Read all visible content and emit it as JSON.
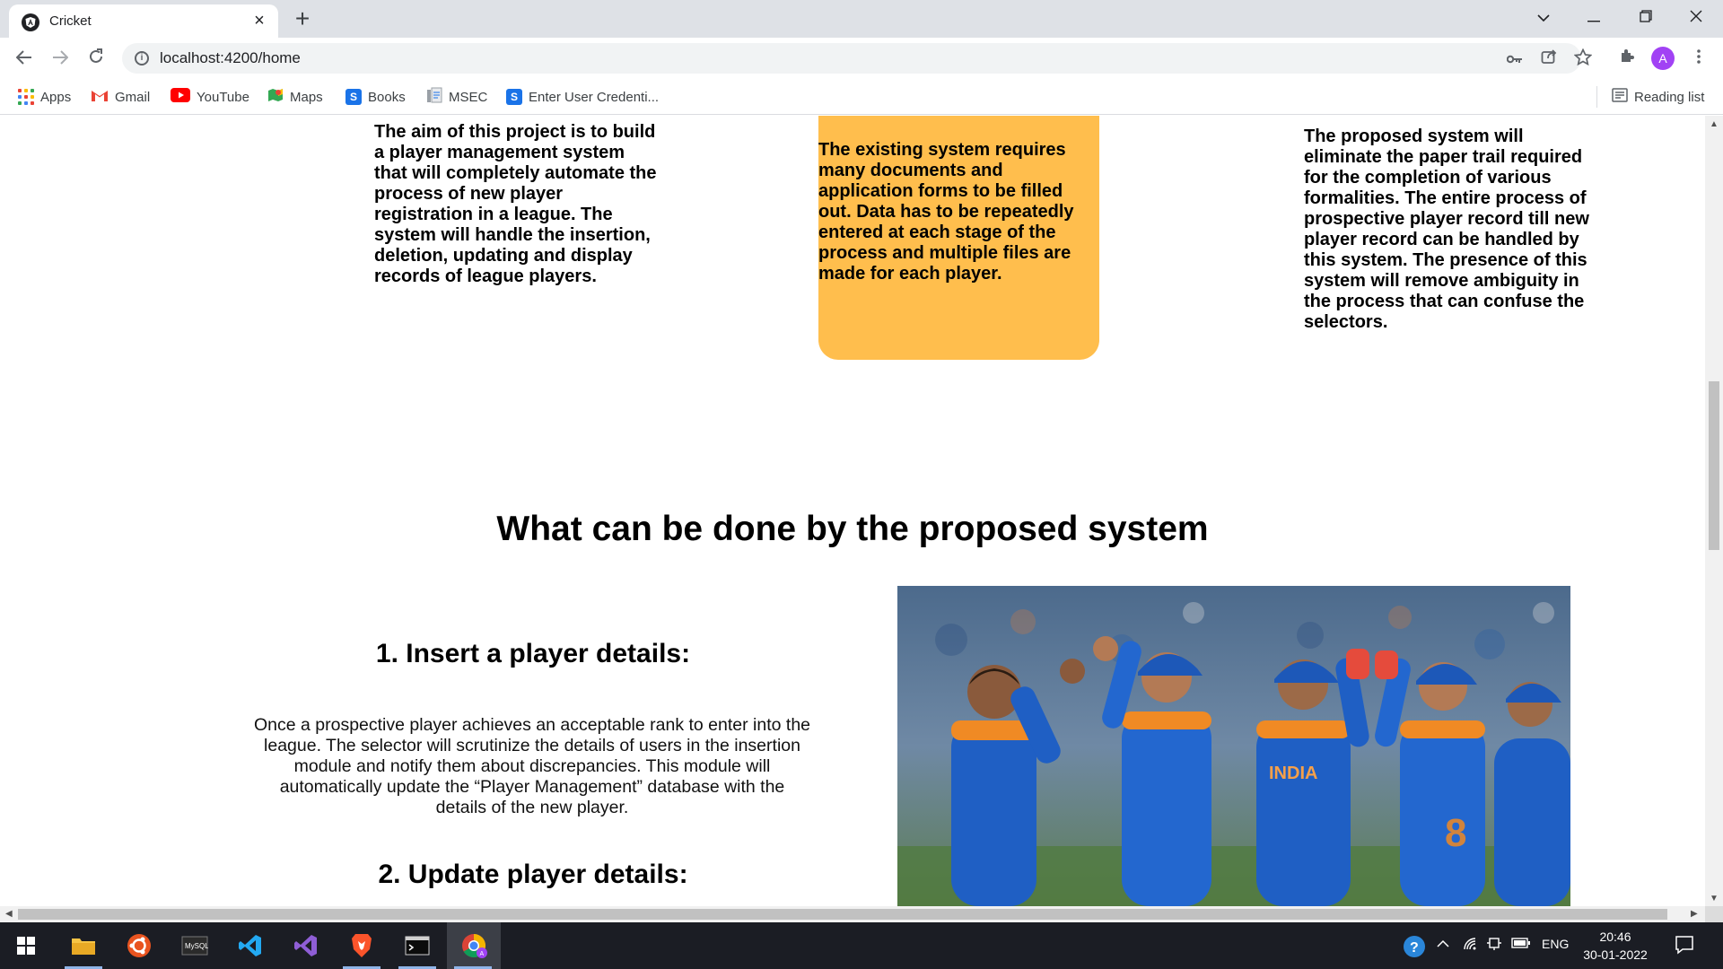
{
  "browser": {
    "tab": {
      "title": "Cricket"
    },
    "address_bar": {
      "url": "localhost:4200/home"
    },
    "profile_initial": "A",
    "bookmarks": [
      {
        "label": "Apps",
        "icon": "apps-grid-icon"
      },
      {
        "label": "Gmail",
        "icon": "gmail-icon"
      },
      {
        "label": "YouTube",
        "icon": "youtube-icon"
      },
      {
        "label": "Maps",
        "icon": "maps-icon"
      },
      {
        "label": "Books",
        "icon": "books-icon"
      },
      {
        "label": "MSEC",
        "icon": "msec-icon"
      },
      {
        "label": "Enter User Credenti...",
        "icon": "credentials-icon"
      }
    ],
    "reading_list": "Reading list"
  },
  "page": {
    "objective_text": "The aim of this project is to build a player management system that will completely automate the process of new player registration in a league. The system will handle the insertion, deletion, updating and display records of league players.",
    "existing_system_text": "The existing system requires many documents and application forms to be filled out. Data has to be repeatedly entered at each stage of the process and multiple files are made for each player.",
    "proposed_system_text": "The proposed system will eliminate the paper trail required for the completion of various formalities. The entire process of prospective player record till new player record can be handled by this system. The presence of this system will remove ambiguity in the process that can confuse the selectors.",
    "section_title": "What can be done by the proposed system",
    "features": [
      {
        "title": "1. Insert a player details:",
        "description": "Once a prospective player achieves an acceptable rank to enter into the league. The selector will scrutinize the details of users in the insertion module and notify them about discrepancies. This module will automatically update the “Player Management” database with the details of the new player."
      },
      {
        "title": "2. Update player details:"
      }
    ],
    "photo": {
      "jersey_text": "INDIA"
    }
  },
  "taskbar": {
    "language": "ENG",
    "time": "20:46",
    "date": "30-01-2022"
  },
  "colors": {
    "card_orange": "#ffbe4d",
    "jersey_blue": "#1f5fc4",
    "jersey_orange": "#f08a24",
    "profile_purple": "#a142f4",
    "taskbar": "#1b1d24"
  }
}
